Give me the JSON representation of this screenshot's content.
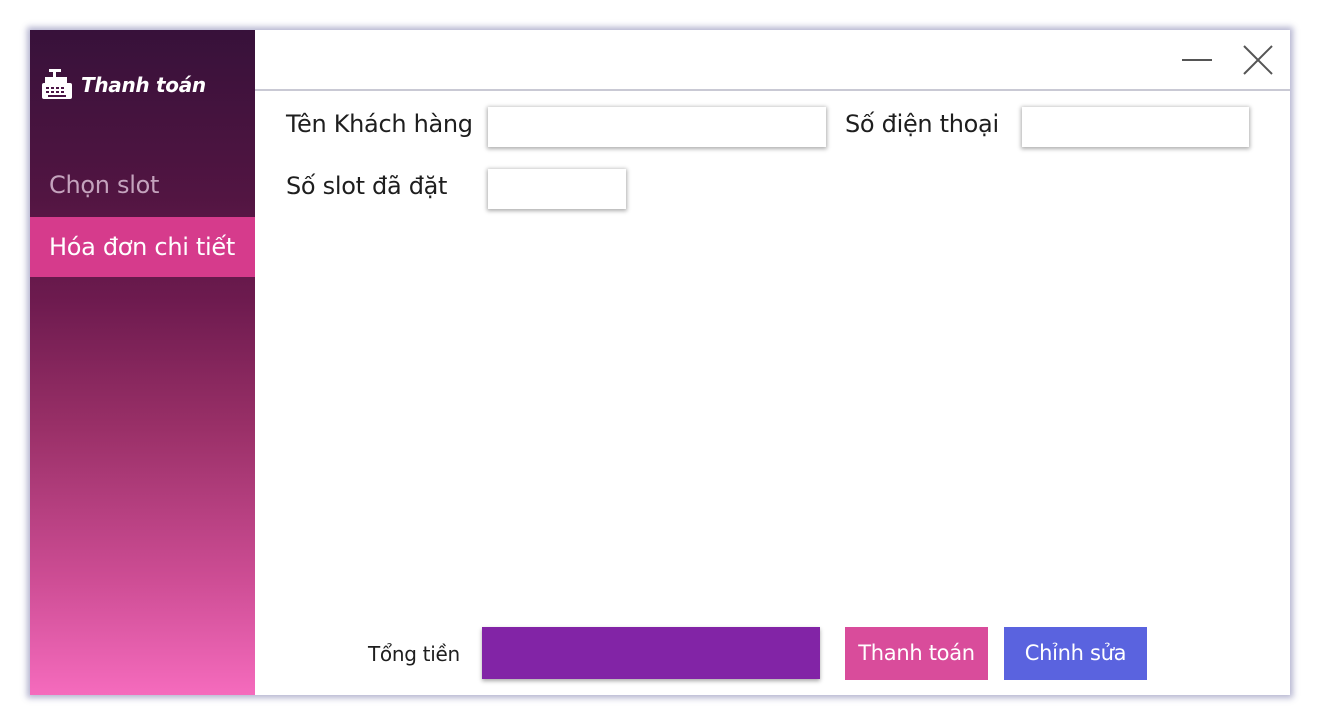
{
  "app": {
    "title": "Thanh toán",
    "icon": "cash-register-icon"
  },
  "sidebar": {
    "items": [
      {
        "label": "Chọn slot",
        "active": false
      },
      {
        "label": "Hóa đơn chi tiết",
        "active": true
      }
    ]
  },
  "window_controls": {
    "minimize_icon": "minimize-icon",
    "close_icon": "close-icon"
  },
  "form": {
    "customer_name": {
      "label": "Tên Khách hàng",
      "value": "",
      "placeholder": ""
    },
    "phone": {
      "label": "Số điện thoại",
      "value": "",
      "placeholder": ""
    },
    "slots_booked": {
      "label": "Số slot đã đặt",
      "value": "",
      "placeholder": ""
    }
  },
  "footer": {
    "total_label": "Tổng tiền",
    "total_value": "",
    "pay_button": "Thanh toán",
    "edit_button": "Chỉnh sửa"
  },
  "colors": {
    "sidebar_gradient_top": "#37113a",
    "sidebar_gradient_bottom": "#f56bbd",
    "active_nav": "#d63b8c",
    "total_box": "#8224a6",
    "pay_button": "#d94c9b",
    "edit_button": "#5a63df"
  }
}
